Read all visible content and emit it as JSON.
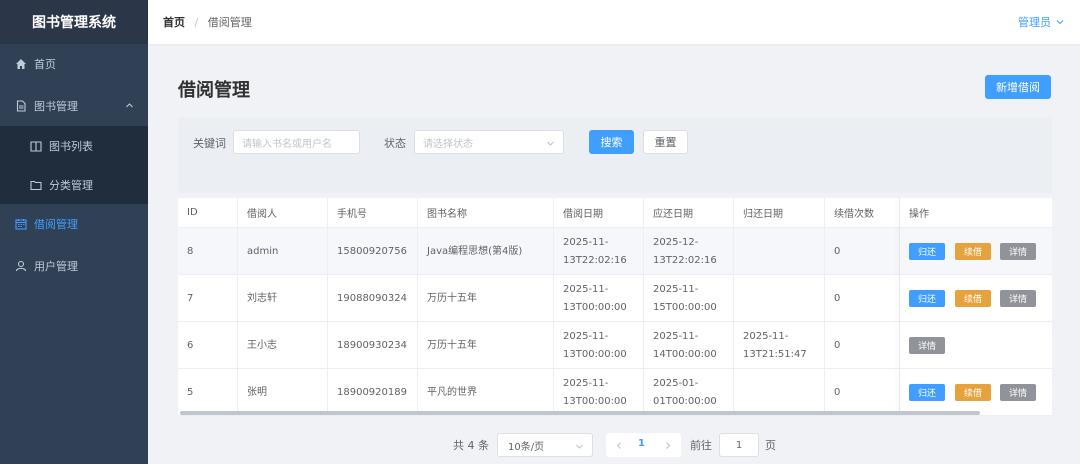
{
  "app": {
    "title": "图书管理系统"
  },
  "sidebar": {
    "items": [
      {
        "label": "首页",
        "icon": "home-icon"
      },
      {
        "label": "图书管理",
        "icon": "document-icon"
      },
      {
        "label": "图书列表",
        "icon": "book-icon"
      },
      {
        "label": "分类管理",
        "icon": "folder-icon"
      },
      {
        "label": "借阅管理",
        "icon": "calendar-icon"
      },
      {
        "label": "用户管理",
        "icon": "user-icon"
      }
    ],
    "active_color": "#409eff"
  },
  "header": {
    "breadcrumb": {
      "home": "首页",
      "separator": "/",
      "current": "借阅管理"
    },
    "user": "管理员"
  },
  "page": {
    "title": "借阅管理",
    "add_label": "新增借阅"
  },
  "search": {
    "keyword_label": "关键词",
    "keyword_placeholder": "请输入书名或用户名",
    "status_label": "状态",
    "status_placeholder": "请选择状态",
    "search_label": "搜索",
    "reset_label": "重置"
  },
  "table": {
    "headers": [
      "ID",
      "借阅人",
      "手机号",
      "图书名称",
      "借阅日期",
      "应还日期",
      "归还日期",
      "续借次数",
      "操作"
    ],
    "rows": [
      {
        "id": "8",
        "borrower": "admin",
        "phone": "15800920756",
        "book": "Java编程思想(第4版)",
        "borrow_date": "2025-11-\n13T22:02:16",
        "due_date": "2025-12-\n13T22:02:16",
        "return_date": "",
        "renew_count": "0",
        "actions": [
          "归还",
          "续借",
          "详情"
        ]
      },
      {
        "id": "7",
        "borrower": "刘志轩",
        "phone": "19088090324",
        "book": "万历十五年",
        "borrow_date": "2025-11-\n13T00:00:00",
        "due_date": "2025-11-\n15T00:00:00",
        "return_date": "",
        "renew_count": "0",
        "actions": [
          "归还",
          "续借",
          "详情"
        ]
      },
      {
        "id": "6",
        "borrower": "王小志",
        "phone": "18900930234",
        "book": "万历十五年",
        "borrow_date": "2025-11-\n13T00:00:00",
        "due_date": "2025-11-\n14T00:00:00",
        "return_date": "2025-11-\n13T21:51:47",
        "renew_count": "0",
        "actions": [
          "详情"
        ]
      },
      {
        "id": "5",
        "borrower": "张明",
        "phone": "18900920189",
        "book": "平凡的世界",
        "borrow_date": "2025-11-\n13T00:00:00",
        "due_date": "2025-01-\n01T00:00:00",
        "return_date": "",
        "renew_count": "0",
        "actions": [
          "归还",
          "续借",
          "详情"
        ]
      }
    ]
  },
  "pagination": {
    "total_text": "共 4 条",
    "page_size": "10条/页",
    "current_page": "1",
    "goto_label": "前往",
    "goto_value": "1",
    "page_unit": "页"
  }
}
